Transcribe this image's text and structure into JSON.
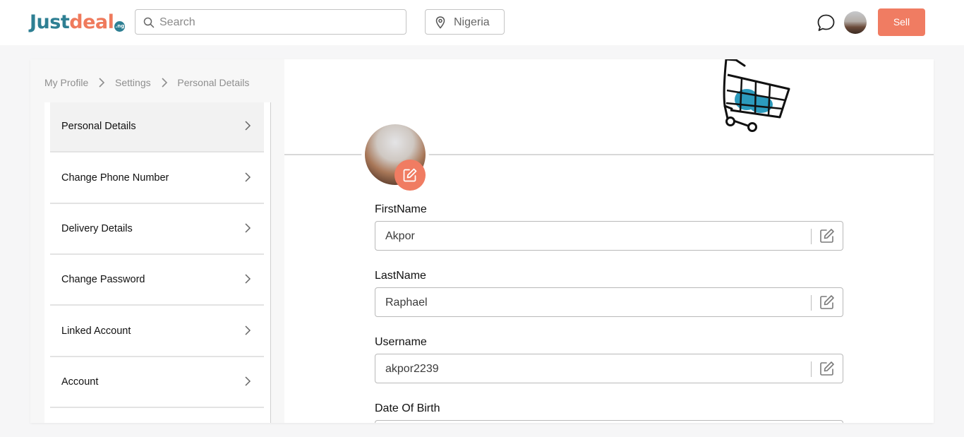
{
  "header": {
    "logo": {
      "part1": "Just",
      "part2": "deal",
      "tld": ".ng"
    },
    "search": {
      "placeholder": "Search",
      "value": ""
    },
    "location": "Nigeria",
    "sell_label": "Sell"
  },
  "breadcrumb": [
    "My Profile",
    "Settings",
    "Personal Details"
  ],
  "menu": {
    "items": [
      {
        "label": "Personal Details",
        "active": true
      },
      {
        "label": "Change Phone Number"
      },
      {
        "label": "Delivery Details"
      },
      {
        "label": "Change Password"
      },
      {
        "label": "Linked Account"
      },
      {
        "label": "Account"
      }
    ]
  },
  "form": {
    "first_name": {
      "label": "FirstName",
      "value": "Akpor"
    },
    "last_name": {
      "label": "LastName",
      "value": "Raphael"
    },
    "username": {
      "label": "Username",
      "value": "akpor2239"
    },
    "dob": {
      "label": "Date Of Birth",
      "value": ""
    }
  },
  "colors": {
    "brand_teal": "#2e7f93",
    "accent_coral": "#f07c62"
  }
}
